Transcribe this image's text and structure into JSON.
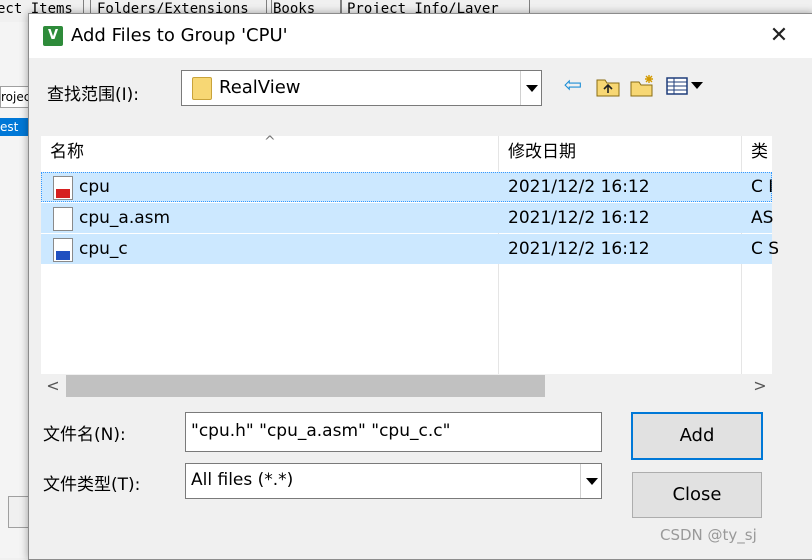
{
  "background_app": {
    "tabs": [
      "ect Items",
      "Folders/Extensions",
      "Books",
      "Project Info/Layer"
    ],
    "project_label": "roject",
    "selected_item": "est"
  },
  "dialog": {
    "title": "Add Files to Group 'CPU'",
    "app_icon_glyph": "V",
    "close_glyph": "✕",
    "look_in": {
      "label": "查找范围(I):",
      "value": "RealView"
    },
    "toolbar_icons": [
      "back-arrow-icon",
      "up-folder-icon",
      "new-folder-icon",
      "view-menu-icon"
    ],
    "columns": [
      "名称",
      "修改日期",
      "类"
    ],
    "files": [
      {
        "name": "cpu",
        "modified": "2021/12/2 16:12",
        "type": "C I",
        "icon": "c-header-file-icon"
      },
      {
        "name": "cpu_a.asm",
        "modified": "2021/12/2 16:12",
        "type": "AS",
        "icon": "asm-file-icon"
      },
      {
        "name": "cpu_c",
        "modified": "2021/12/2 16:12",
        "type": "C S",
        "icon": "c-source-file-icon"
      }
    ],
    "file_name": {
      "label": "文件名(N):",
      "value": "\"cpu.h\" \"cpu_a.asm\" \"cpu_c.c\""
    },
    "file_type": {
      "label": "文件类型(T):",
      "value": "All files (*.*)"
    },
    "add_label": "Add",
    "close_label": "Close",
    "selection_color": "#cce8ff",
    "accent_color": "#0078d7"
  },
  "watermark": "CSDN @ty_sj"
}
